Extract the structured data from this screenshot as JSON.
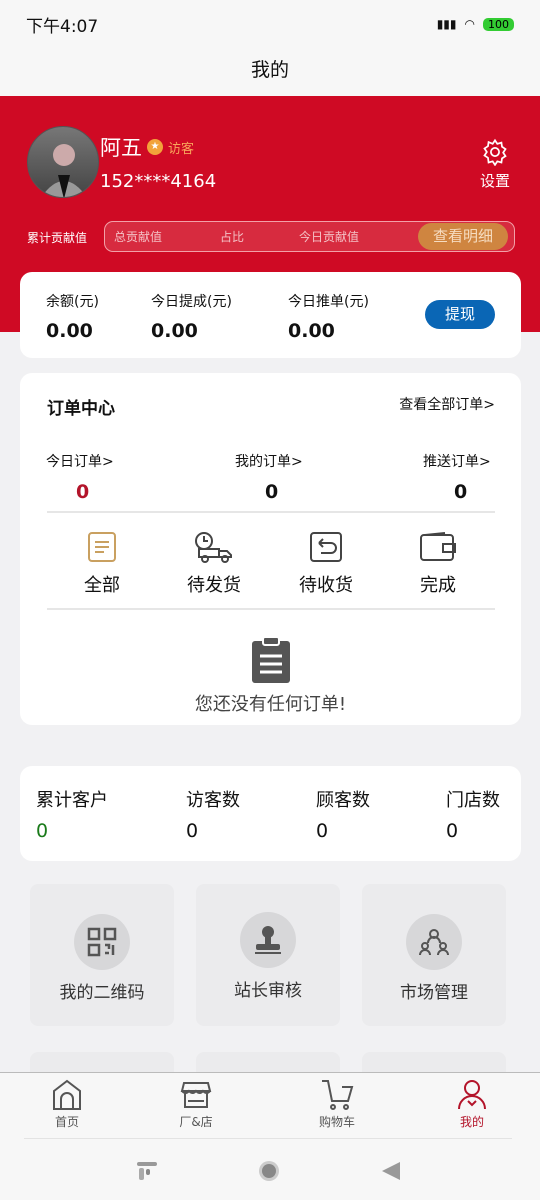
{
  "status": {
    "time": "下午4:07",
    "battery": "100"
  },
  "title": "我的",
  "profile": {
    "name": "阿五",
    "role": "访客",
    "phone": "152****4164",
    "settings": "设置"
  },
  "contribution": {
    "label": "累计贡献值",
    "total": "总贡献值",
    "ratio": "占比",
    "today": "今日贡献值",
    "detail": "查看明细"
  },
  "balance": {
    "items": [
      {
        "label": "余额(元)",
        "value": "0.00"
      },
      {
        "label": "今日提成(元)",
        "value": "0.00"
      },
      {
        "label": "今日推单(元)",
        "value": "0.00"
      }
    ],
    "withdraw": "提现"
  },
  "orders": {
    "title": "订单中心",
    "view_all": "查看全部订单>",
    "stats": [
      {
        "label": "今日订单>",
        "value": "0"
      },
      {
        "label": "我的订单>",
        "value": "0"
      },
      {
        "label": "推送订单>",
        "value": "0"
      }
    ],
    "types": [
      "全部",
      "待发货",
      "待收货",
      "完成"
    ],
    "empty": "您还没有任何订单!"
  },
  "customers": [
    {
      "label": "累计客户",
      "value": "0"
    },
    {
      "label": "访客数",
      "value": "0"
    },
    {
      "label": "顾客数",
      "value": "0"
    },
    {
      "label": "门店数",
      "value": "0"
    }
  ],
  "tiles": [
    "我的二维码",
    "站长审核",
    "市场管理"
  ],
  "nav": [
    {
      "label": "首页",
      "icon": "home-icon"
    },
    {
      "label": "厂&店",
      "icon": "store-icon"
    },
    {
      "label": "购物车",
      "icon": "cart-icon"
    },
    {
      "label": "我的",
      "icon": "user-icon",
      "active": true
    }
  ],
  "colors": {
    "brand": "#cf0a24",
    "accent": "#0a66b5",
    "active_nav": "#b3142a"
  }
}
